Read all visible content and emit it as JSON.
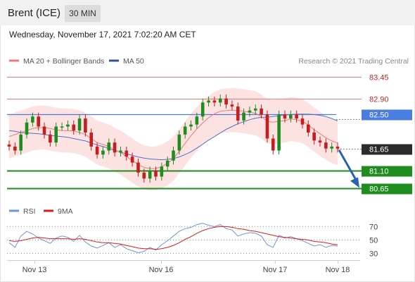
{
  "header": {
    "instrument": "Brent (ICE)",
    "timeframe": "30 MIN",
    "datetime": "Wednesday, November 17, 2021 7:02:20 AM CET"
  },
  "legend": {
    "ma20_label": "MA 20 + Bollinger Bands",
    "ma50_label": "MA 50",
    "credit": "Research © 2021 Trading Central",
    "rsi_label": "RSI",
    "rsi_ma_label": "9MA"
  },
  "colors": {
    "ma20": "#f07a7a",
    "band_fill": "#fde2e2",
    "ma50": "#4c74c9",
    "pivot": "#4a7de0",
    "support": "#1e8c1e",
    "candle_up": "#1e8c1e",
    "candle_down": "#c41e1e",
    "last_price": "#2b2b2b",
    "arrow": "#2a62b0",
    "rsi": "#6f93dd",
    "rsi_ma": "#e01a1a"
  },
  "chart_data": [
    {
      "type": "candlestick",
      "title": "Brent (ICE) 30 MIN",
      "ylim": [
        80.5,
        83.6
      ],
      "x_tick_labels": [
        "Nov 13",
        "Nov 16",
        "Nov 17",
        "Nov 18"
      ],
      "levels": [
        {
          "label": "83.45",
          "value": 83.45,
          "kind": "resistance"
        },
        {
          "label": "82.90",
          "value": 82.9,
          "kind": "resistance"
        },
        {
          "label": "82.50",
          "value": 82.5,
          "kind": "pivot"
        },
        {
          "label": "81.65",
          "value": 81.65,
          "kind": "last"
        },
        {
          "label": "81.10",
          "value": 81.1,
          "kind": "support"
        },
        {
          "label": "80.65",
          "value": 80.65,
          "kind": "support"
        }
      ],
      "closes": [
        81.7,
        81.6,
        82.0,
        82.3,
        82.45,
        82.2,
        82.0,
        81.8,
        82.2,
        82.2,
        82.25,
        82.1,
        82.4,
        82.05,
        81.7,
        81.5,
        81.6,
        81.8,
        81.55,
        81.6,
        81.45,
        81.3,
        81.05,
        80.9,
        81.1,
        80.95,
        81.2,
        81.35,
        81.6,
        82.0,
        82.2,
        82.25,
        82.45,
        82.8,
        82.85,
        82.8,
        82.9,
        82.75,
        82.7,
        82.35,
        82.55,
        82.6,
        82.65,
        82.5,
        81.9,
        81.6,
        82.5,
        82.4,
        82.5,
        82.4,
        82.25,
        82.05,
        81.85,
        81.8,
        81.65,
        81.7,
        81.65
      ],
      "ma20": [
        81.95,
        82.0,
        82.05,
        82.1,
        82.15,
        82.17,
        82.18,
        82.15,
        82.12,
        82.1,
        82.1,
        82.09,
        82.05,
        82.0,
        81.9,
        81.8,
        81.75,
        81.7,
        81.62,
        81.55,
        81.45,
        81.35,
        81.25,
        81.18,
        81.15,
        81.15,
        81.2,
        81.28,
        81.4,
        81.58,
        81.78,
        81.97,
        82.14,
        82.29,
        82.42,
        82.52,
        82.58,
        82.6,
        82.61,
        82.6,
        82.58,
        82.56,
        82.53,
        82.45,
        82.33,
        82.31,
        82.33,
        82.35,
        82.39,
        82.37,
        82.33,
        82.24,
        82.12,
        82.02,
        81.92,
        81.84,
        81.79
      ],
      "ma50": [
        82.1,
        82.08,
        82.05,
        82.04,
        82.03,
        82.02,
        82.0,
        81.98,
        81.96,
        81.95,
        81.93,
        81.9,
        81.87,
        81.84,
        81.79,
        81.74,
        81.7,
        81.65,
        81.6,
        81.56,
        81.52,
        81.48,
        81.44,
        81.41,
        81.39,
        81.38,
        81.37,
        81.38,
        81.4,
        81.44,
        81.5,
        81.57,
        81.66,
        81.76,
        81.86,
        81.95,
        82.04,
        82.13,
        82.2,
        82.27,
        82.32,
        82.37,
        82.41,
        82.43,
        82.43,
        82.45,
        82.47,
        82.49,
        82.5,
        82.51,
        82.51,
        82.51,
        82.5,
        82.48,
        82.45,
        82.4,
        82.34
      ],
      "bb_width": 0.55
    },
    {
      "type": "line",
      "title": "RSI",
      "ylim": [
        20,
        80
      ],
      "y_ticks": [
        70,
        50,
        30
      ],
      "series": [
        {
          "name": "RSI",
          "values": [
            45,
            38,
            55,
            62,
            58,
            52,
            48,
            44,
            52,
            55,
            53,
            47,
            56,
            46,
            40,
            37,
            41,
            45,
            38,
            42,
            36,
            33,
            30,
            32,
            38,
            34,
            42,
            48,
            55,
            62,
            66,
            68,
            72,
            74,
            71,
            69,
            72,
            66,
            64,
            55,
            58,
            60,
            59,
            55,
            42,
            38,
            56,
            52,
            54,
            51,
            48,
            44,
            40,
            42,
            38,
            41,
            40
          ]
        },
        {
          "name": "9MA",
          "values": [
            48,
            47,
            48,
            50,
            52,
            53,
            52,
            51,
            51,
            51,
            51,
            50,
            51,
            50,
            48,
            46,
            45,
            45,
            44,
            43,
            41,
            39,
            37,
            36,
            36,
            35,
            36,
            38,
            41,
            45,
            50,
            54,
            59,
            63,
            66,
            68,
            69,
            69,
            68,
            66,
            65,
            63,
            62,
            60,
            58,
            56,
            54,
            53,
            52,
            51,
            50,
            49,
            47,
            46,
            45,
            43,
            42
          ]
        }
      ]
    }
  ]
}
